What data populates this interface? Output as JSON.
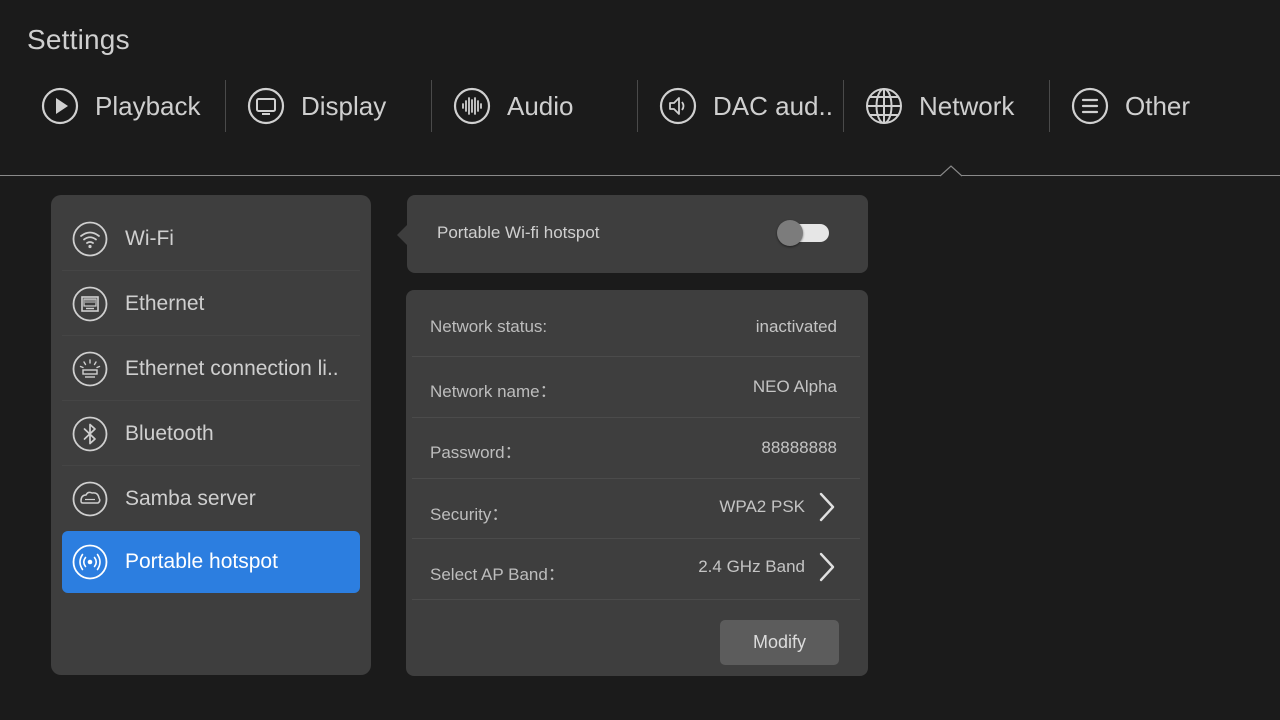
{
  "app": {
    "title": "Settings"
  },
  "tabs": [
    {
      "label": "Playback",
      "icon": "play-circle-icon"
    },
    {
      "label": "Display",
      "icon": "monitor-icon"
    },
    {
      "label": "Audio",
      "icon": "audio-waveform-icon"
    },
    {
      "label": "DAC aud..",
      "icon": "speaker-icon"
    },
    {
      "label": "Network",
      "icon": "globe-icon",
      "selected": true
    },
    {
      "label": "Other",
      "icon": "menu-lines-icon"
    }
  ],
  "network_menu": {
    "items": [
      {
        "label": "Wi-Fi",
        "icon": "wifi-icon"
      },
      {
        "label": "Ethernet",
        "icon": "ethernet-port-icon"
      },
      {
        "label": "Ethernet connection li..",
        "icon": "ethernet-light-icon"
      },
      {
        "label": "Bluetooth",
        "icon": "bluetooth-icon"
      },
      {
        "label": "Samba server",
        "icon": "samba-server-icon"
      },
      {
        "label": "Portable hotspot",
        "icon": "hotspot-icon",
        "active": true
      }
    ]
  },
  "hotspot": {
    "label": "Portable Wi-fi hotspot",
    "enabled": false
  },
  "details": {
    "rows": [
      {
        "label": "Network status:",
        "value": "inactivated"
      },
      {
        "label": "Network name：",
        "value": "NEO Alpha"
      },
      {
        "label": "Password：",
        "value": "88888888"
      },
      {
        "label": "Security：",
        "value": "WPA2 PSK"
      },
      {
        "label": "Select AP Band：",
        "value": "2.4 GHz Band"
      }
    ],
    "modify_label": "Modify"
  },
  "colors": {
    "background": "#1b1b1b",
    "panel": "#3e3e3e",
    "accent": "#2c7ee0",
    "text": "#cfcfcf"
  }
}
